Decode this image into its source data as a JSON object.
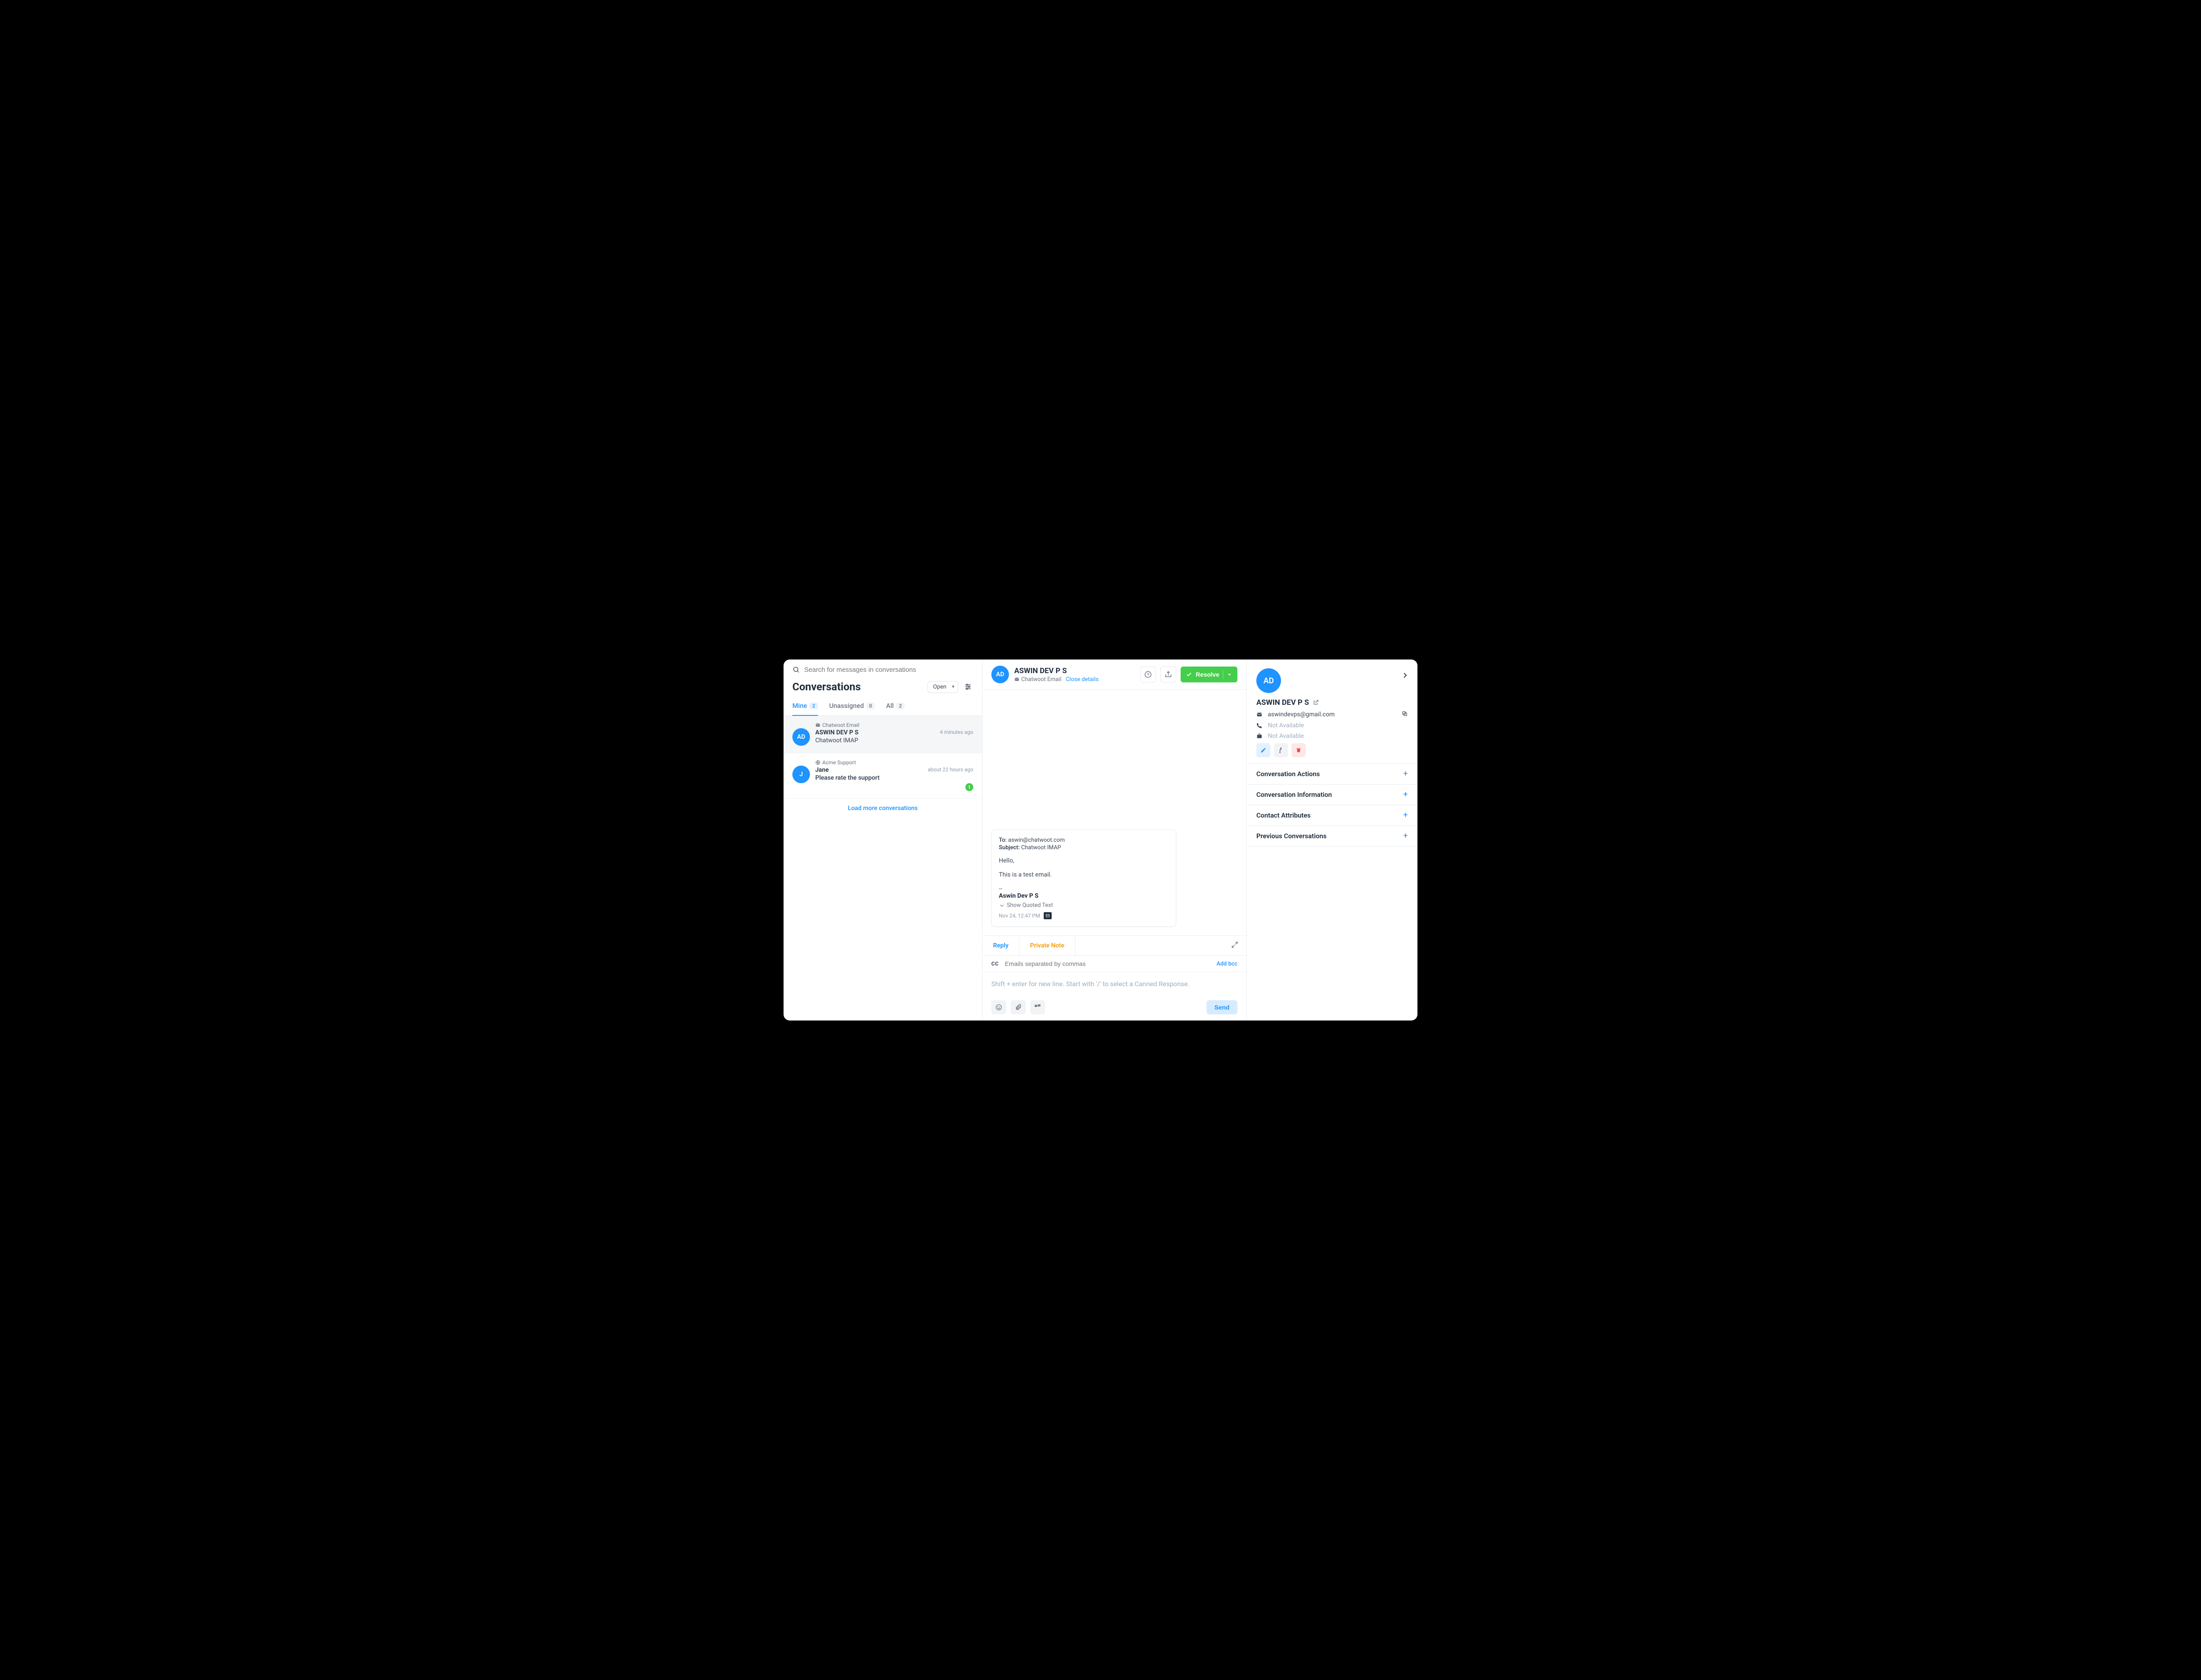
{
  "search": {
    "placeholder": "Search for messages in conversations"
  },
  "convs_header": {
    "title": "Conversations",
    "status": "Open"
  },
  "tabs": {
    "mine": {
      "label": "Mine",
      "count": "2"
    },
    "unassigned": {
      "label": "Unassigned",
      "count": "0"
    },
    "all": {
      "label": "All",
      "count": "2"
    }
  },
  "conversations": [
    {
      "channel": "Chatwoot Email",
      "avatar_initials": "AD",
      "name": "ASWIN DEV P S",
      "time": "4 minutes ago",
      "preview": "Chatwoot IMAP",
      "preview_bold": false,
      "unread": null
    },
    {
      "channel": "Acme Support",
      "avatar_initials": "J",
      "name": "Jane",
      "time": "about 22 hours ago",
      "preview": "Please rate the support",
      "preview_bold": true,
      "unread": "1"
    }
  ],
  "load_more": "Load more conversations",
  "chat_header": {
    "avatar_initials": "AD",
    "name": "ASWIN DEV P S",
    "channel": "Chatwoot Email",
    "close_details": "Close details",
    "resolve": "Resolve"
  },
  "email": {
    "to_label": "To:",
    "to_value": "aswin@chatwoot.com",
    "subject_label": "Subject:",
    "subject_value": "Chatwoot IMAP",
    "body_line1": "Hello,",
    "body_line2": "This is a test email.",
    "body_sigdash": "--",
    "body_signame": "Aswin Dev P S",
    "show_quoted": "Show Quoted Text",
    "timestamp": "Nov 24, 12:47 PM"
  },
  "reply": {
    "tab_reply": "Reply",
    "tab_note": "Private Note",
    "cc_label": "CC",
    "cc_placeholder": "Emails separated by commas",
    "add_bcc": "Add bcc",
    "placeholder": "Shift + enter for new line. Start with '/' to select a Canned Response.",
    "send": "Send"
  },
  "contact": {
    "avatar_initials": "AD",
    "name": "ASWIN DEV P S",
    "email": "aswindevps@gmail.com",
    "phone": "Not Available",
    "company": "Not Available"
  },
  "accordion": {
    "actions": "Conversation Actions",
    "info": "Conversation Information",
    "attrs": "Contact Attributes",
    "prev": "Previous Conversations"
  }
}
